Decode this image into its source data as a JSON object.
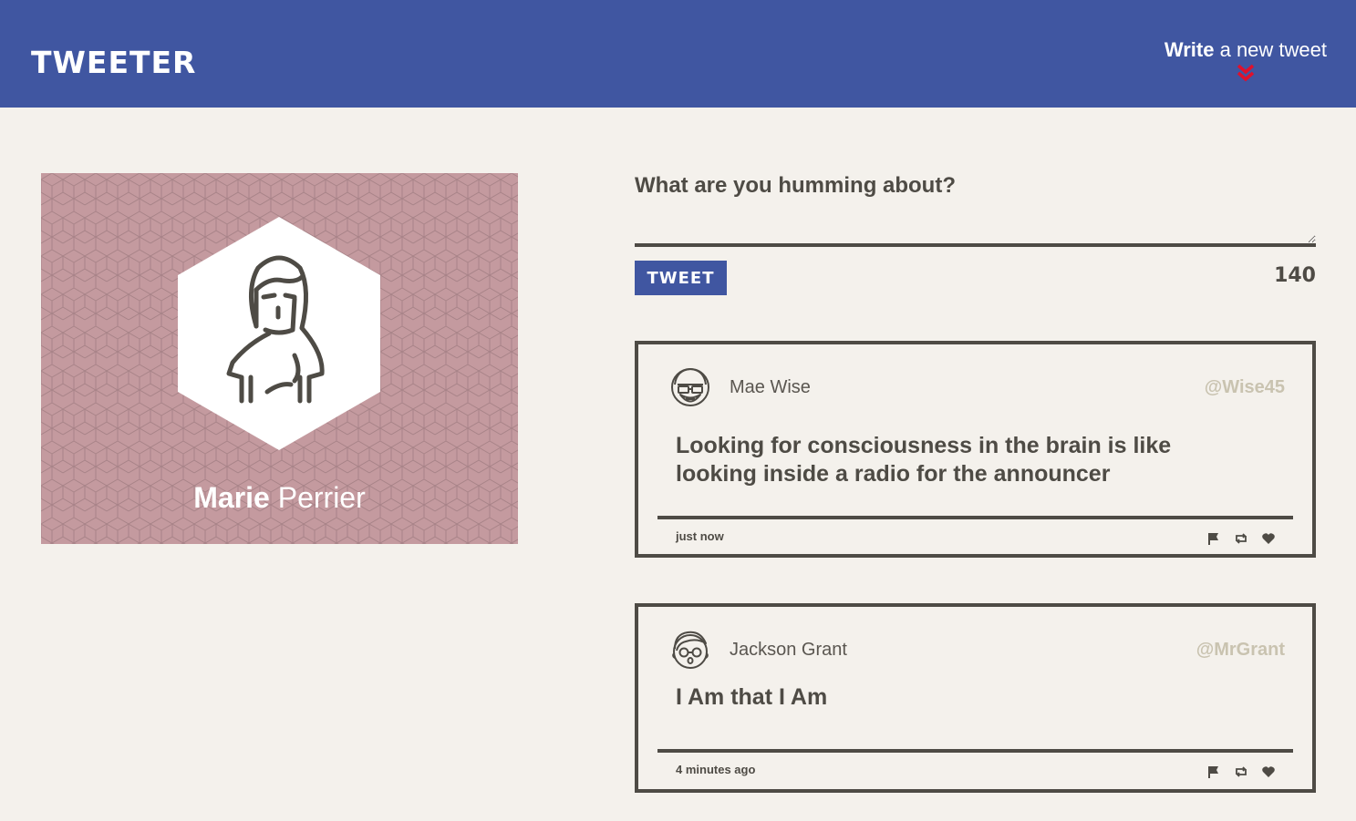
{
  "nav": {
    "logo": "TWEETER",
    "write_bold": "Write",
    "write_rest": " a new tweet",
    "write_icon": "double-chevron-down-icon",
    "accent_color": "#e0102c",
    "bar_color": "#4056a1"
  },
  "profile": {
    "first_name": "Marie",
    "last_name": " Perrier",
    "background_color": "#c49a9f",
    "avatar_icon": "woman-avatar-icon"
  },
  "compose": {
    "label": "What are you humming about?",
    "value": "",
    "button_label": "TWEET",
    "counter": "140"
  },
  "tweets": [
    {
      "name": "Mae Wise",
      "handle": "@Wise45",
      "text": "Looking for consciousness in the brain is like looking inside a radio for the announcer",
      "time": "just now",
      "avatar_icon": "bearded-glasses-avatar-icon"
    },
    {
      "name": "Jackson Grant",
      "handle": "@MrGrant",
      "text": "I Am that I Am",
      "time": "4 minutes ago",
      "avatar_icon": "glasses-man-avatar-icon"
    }
  ],
  "actions": [
    "flag-icon",
    "retweet-icon",
    "heart-icon"
  ]
}
